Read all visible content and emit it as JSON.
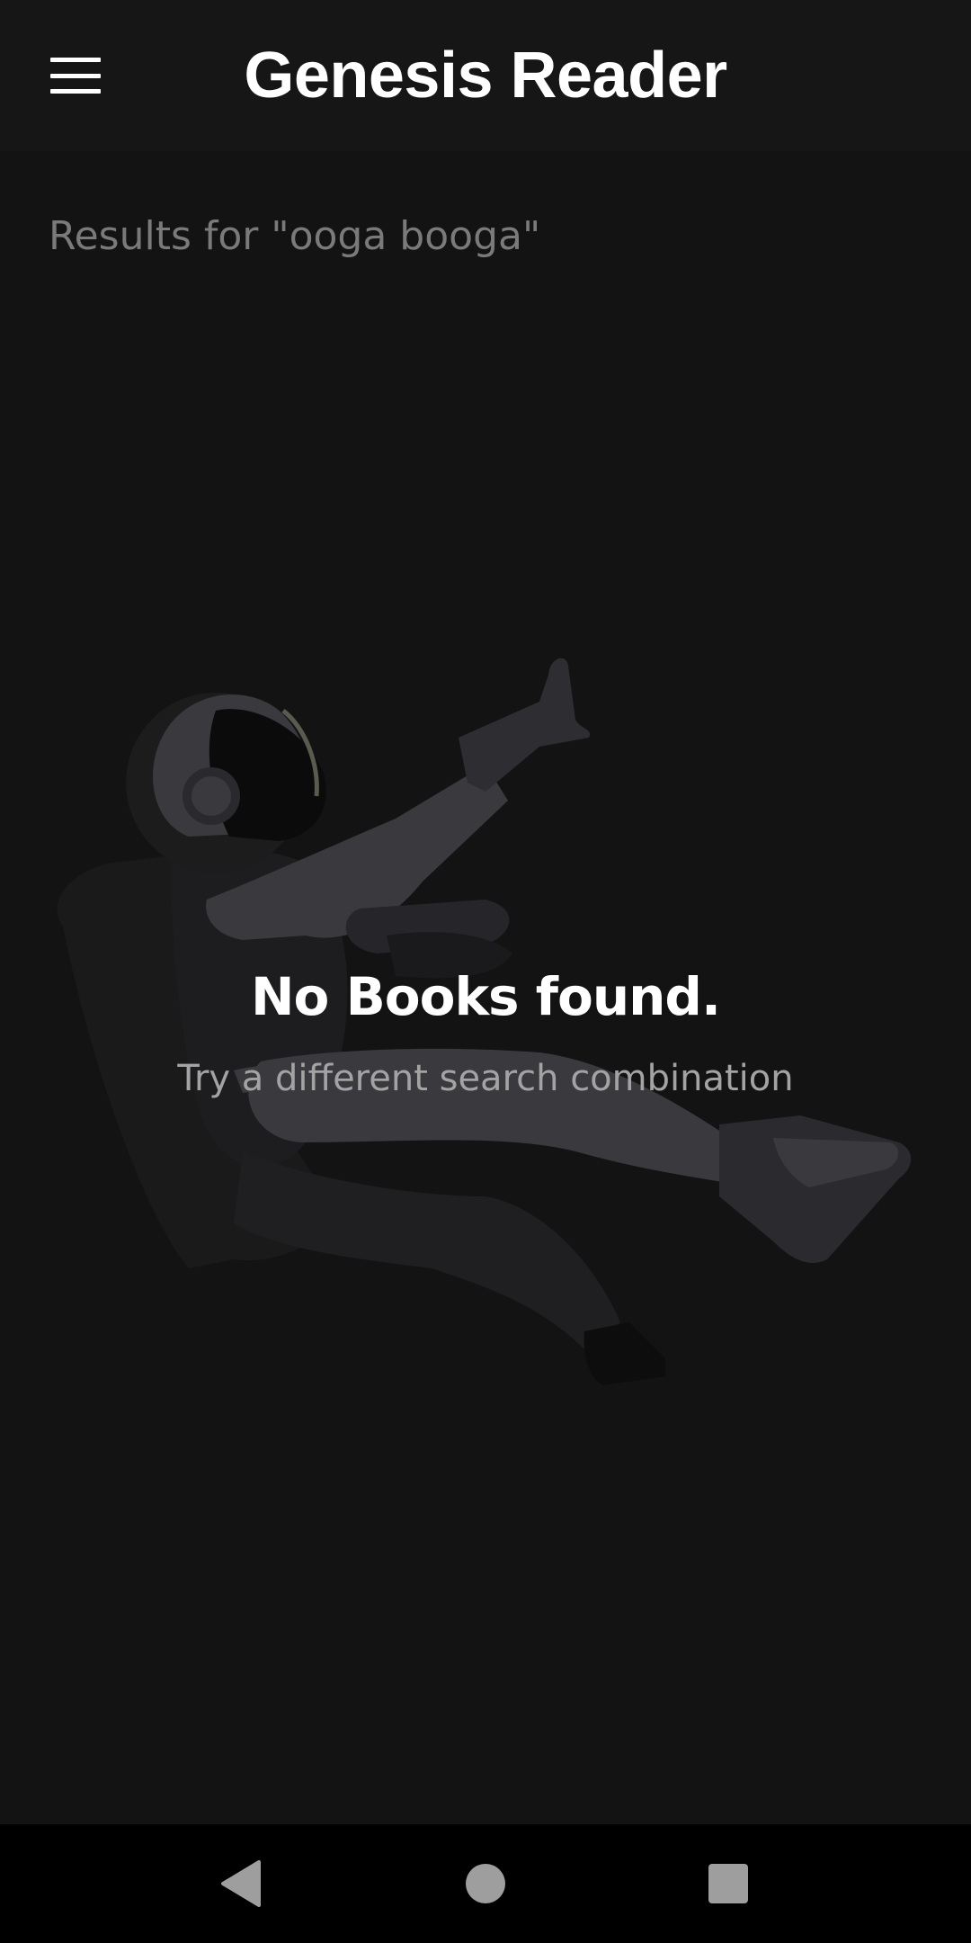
{
  "app_bar": {
    "title": "Genesis Reader",
    "menu_icon": "hamburger-menu-icon"
  },
  "search": {
    "results_label": "Results for \"ooga booga\""
  },
  "empty_state": {
    "title": "No Books found.",
    "subtitle": "Try a different search combination",
    "illustration": "floating-astronaut-illustration"
  },
  "nav_bar": {
    "back_icon": "back-triangle-icon",
    "home_icon": "home-circle-icon",
    "recents_icon": "recents-square-icon"
  },
  "colors": {
    "background": "#131313",
    "app_bar": "#161616",
    "title_text": "#ffffff",
    "muted_text": "#7a7a7a",
    "subtitle_text": "#a3a3a3",
    "illustration_gray": "#3a3a3e",
    "nav_bar": "#000000",
    "nav_icons": "#9e9e9e"
  }
}
